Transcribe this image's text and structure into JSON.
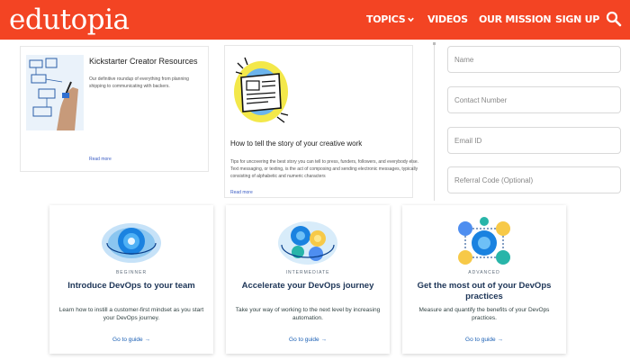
{
  "header": {
    "logo": "edutopia",
    "nav": {
      "topics": "TOPICS",
      "videos": "VIDEOS",
      "mission": "OUR MISSION",
      "signup": "SIGN UP"
    },
    "icons": {
      "topics_chevron": "chevron-down-icon",
      "search": "search-icon"
    },
    "colors": {
      "brand": "#f34423"
    }
  },
  "cards": [
    {
      "title": "Kickstarter Creator Resources",
      "description": "Our definitive roundup of everything from planning shipping to communicating with backers.",
      "read_more": "Read more"
    },
    {
      "title": "How to tell the story of your creative work",
      "description": "Tips for uncovering the best story you can tell to press, funders, followers, and everybody else. Text messaging, or texting, is the act of composing and sending electronic messages, typically consisting of alphabetic and numeric characters",
      "read_more": "Read more"
    }
  ],
  "form": {
    "name_placeholder": "Name",
    "contact_placeholder": "Contact Number",
    "email_placeholder": "Email ID",
    "referral_placeholder": "Referral Code (Optional)"
  },
  "guides": [
    {
      "level": "BEGINNER",
      "title": "Introduce DevOps to your team",
      "description": "Learn how to instill a customer-first mindset as you start your DevOps journey.",
      "link": "Go to guide →"
    },
    {
      "level": "INTERMEDIATE",
      "title": "Accelerate your DevOps journey",
      "description": "Take your way of working to the next level by increasing automation.",
      "link": "Go to guide →"
    },
    {
      "level": "ADVANCED",
      "title": "Get the most out of your DevOps practices",
      "description": "Measure and quantify the benefits of your DevOps practices.",
      "link": "Go to guide →"
    }
  ]
}
